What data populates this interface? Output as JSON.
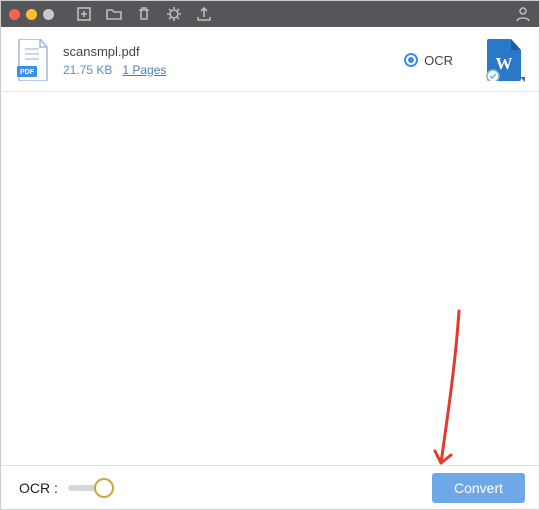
{
  "file": {
    "name": "scansmpl.pdf",
    "size": "21.75 KB",
    "pages": "1 Pages",
    "ocr_option_label": "OCR"
  },
  "footer": {
    "ocr_label": "OCR :",
    "convert_label": "Convert"
  },
  "icons": {
    "toolbar": [
      "add-file",
      "open-folder",
      "trash",
      "settings",
      "export"
    ],
    "output_format": "word"
  },
  "colors": {
    "brand_blue": "#3d8ee8",
    "word_blue": "#2a78c8",
    "link_blue": "#4f7fb8"
  }
}
